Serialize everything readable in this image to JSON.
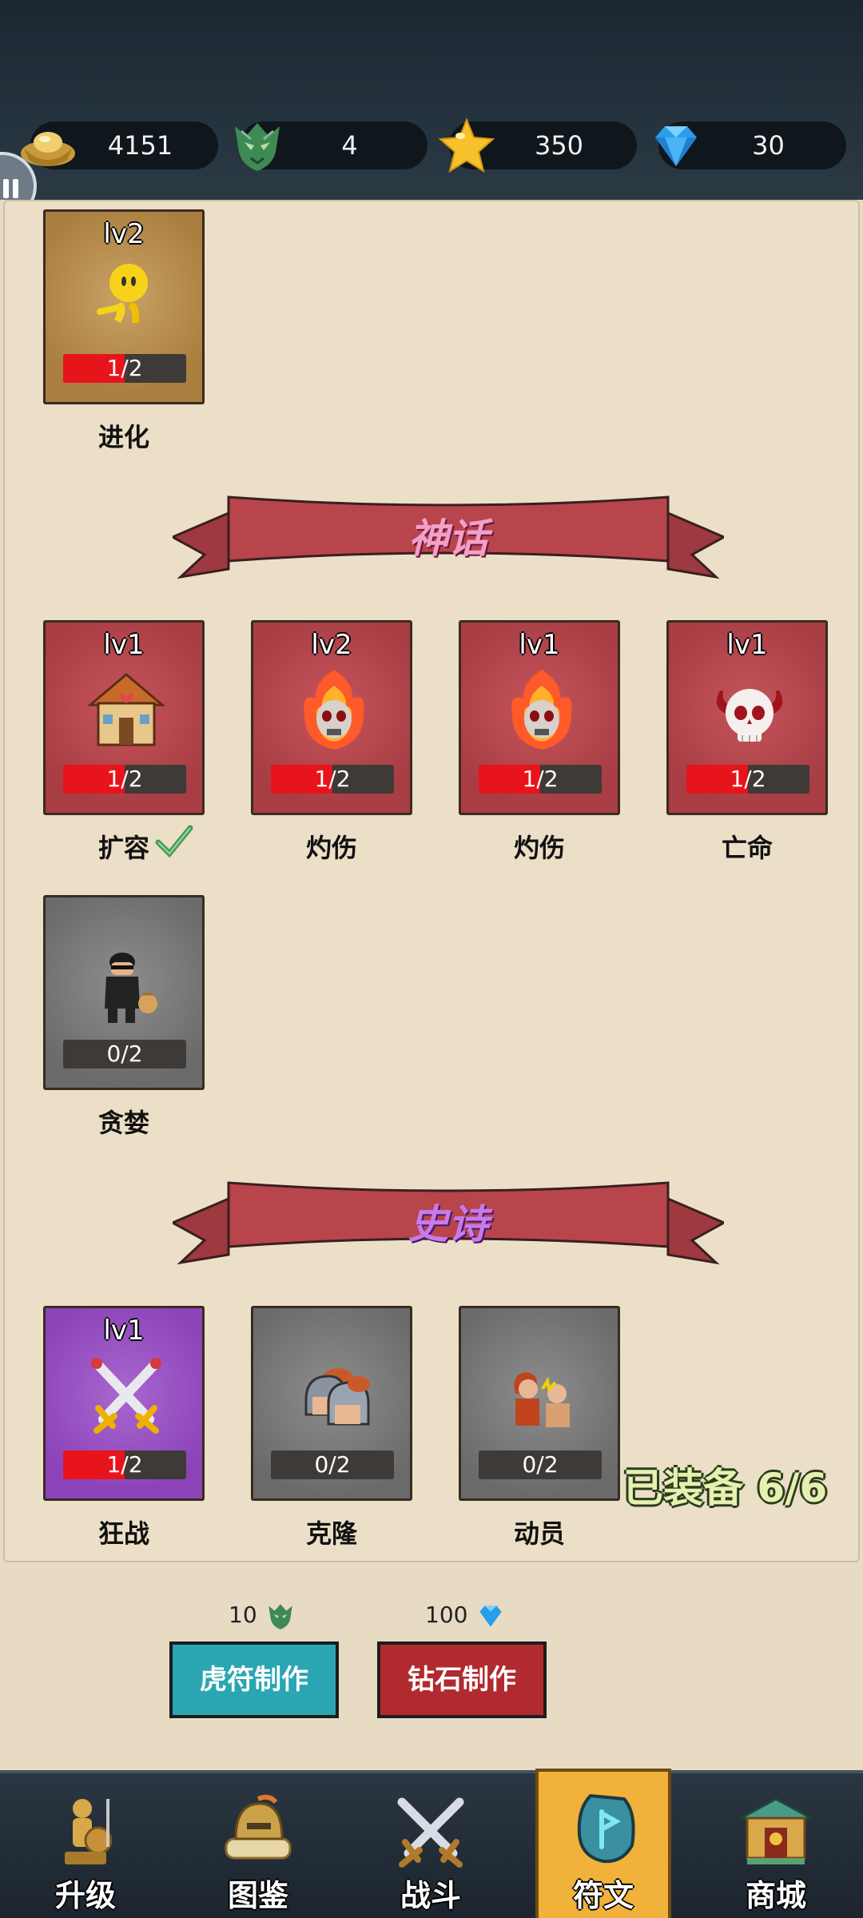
{
  "resources": [
    {
      "name": "gold-ingot",
      "value": "4151"
    },
    {
      "name": "tiger-token",
      "value": "4"
    },
    {
      "name": "star",
      "value": "350"
    },
    {
      "name": "diamond",
      "value": "30"
    }
  ],
  "top_section": {
    "cards": [
      {
        "lv": "lv2",
        "progress": "1/2",
        "name": "进化",
        "rarity": "gold",
        "icon": "yellow-runner-icon",
        "fill": 0.5
      }
    ]
  },
  "mythic": {
    "banner": "神话",
    "cards": [
      {
        "lv": "lv1",
        "progress": "1/2",
        "name": "扩容",
        "rarity": "red",
        "icon": "house-icon",
        "fill": 0.5
      },
      {
        "lv": "lv2",
        "progress": "1/2",
        "name": "灼伤",
        "rarity": "red",
        "icon": "flaming-skull-icon",
        "fill": 0.5
      },
      {
        "lv": "lv1",
        "progress": "1/2",
        "name": "灼伤",
        "rarity": "red",
        "icon": "flaming-skull-icon",
        "fill": 0.5
      },
      {
        "lv": "lv1",
        "progress": "1/2",
        "name": "亡命",
        "rarity": "red",
        "icon": "horned-skull-icon",
        "fill": 0.5
      },
      {
        "lv": "",
        "progress": "0/2",
        "name": "贪婪",
        "rarity": "gray",
        "icon": "thief-icon",
        "fill": 0
      }
    ]
  },
  "epic": {
    "banner": "史诗",
    "cards": [
      {
        "lv": "lv1",
        "progress": "1/2",
        "name": "狂战",
        "rarity": "purple",
        "icon": "crossed-swords-icon",
        "fill": 0.5
      },
      {
        "lv": "",
        "progress": "0/2",
        "name": "克隆",
        "rarity": "gray",
        "icon": "helmets-icon",
        "fill": 0
      },
      {
        "lv": "",
        "progress": "0/2",
        "name": "动员",
        "rarity": "gray",
        "icon": "fighters-icon",
        "fill": 0
      }
    ]
  },
  "crafting": {
    "tiger_cost": "10",
    "diamond_cost": "100",
    "tiger_button": "虎符制作",
    "diamond_button": "钻石制作",
    "equipped": "已装备 6/6"
  },
  "nav": [
    {
      "label": "升级",
      "icon": "warrior-statue-icon",
      "active": false
    },
    {
      "label": "图鉴",
      "icon": "helmet-scroll-icon",
      "active": false
    },
    {
      "label": "战斗",
      "icon": "crossed-swords-icon",
      "active": false
    },
    {
      "label": "符文",
      "icon": "rune-stone-icon",
      "active": true
    },
    {
      "label": "商城",
      "icon": "shop-icon",
      "active": false
    }
  ],
  "colors": {
    "mythic_banner": "#b8454c",
    "mythic_text": "#f2a0c8",
    "epic_text": "#c77be8",
    "progress_fill": "#e8141c",
    "active_tab": "#f0b23a"
  }
}
